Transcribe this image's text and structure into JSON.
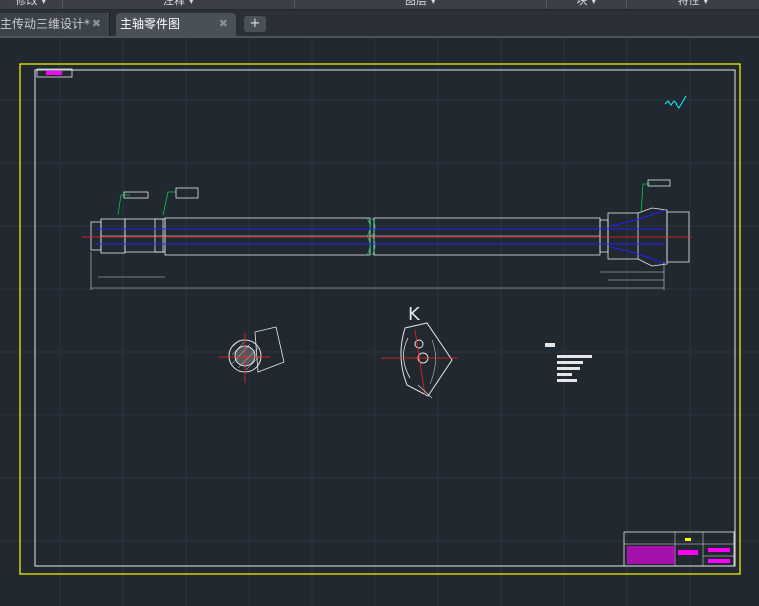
{
  "ribbon": {
    "panels": [
      {
        "label": "修改 ▾"
      },
      {
        "label": "注释 ▾"
      },
      {
        "label": "图层 ▾"
      },
      {
        "label": "块 ▾"
      },
      {
        "label": "特性 ▾"
      }
    ]
  },
  "tabs": [
    {
      "label": "主传动三维设计*",
      "active": false
    },
    {
      "label": "主轴零件图",
      "active": true
    }
  ],
  "add_tab_label": "+",
  "drawing": {
    "section_label": "K"
  },
  "colors": {
    "background": "#212830",
    "frame": "#ffff00",
    "geometry": "#ffffff",
    "centerline": "#ff2020",
    "hidden": "#1a1aff",
    "leader": "#00cc44",
    "highlight": "#ff00ff",
    "symbol": "#00ffff"
  }
}
